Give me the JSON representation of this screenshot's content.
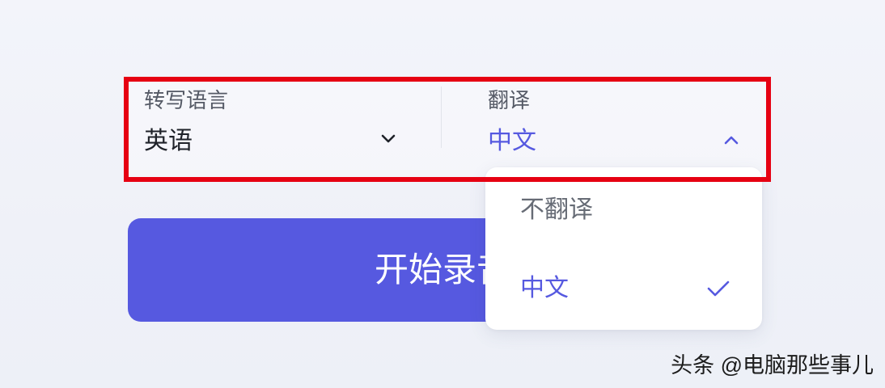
{
  "transcribe": {
    "label": "转写语言",
    "value": "英语",
    "icon": "chevron-down-icon"
  },
  "translate": {
    "label": "翻译",
    "value": "中文",
    "icon": "chevron-up-icon",
    "expanded": true
  },
  "dropdown": {
    "options": [
      {
        "label": "不翻译",
        "selected": false
      },
      {
        "label": "中文",
        "selected": true
      }
    ],
    "selected_icon": "check-icon"
  },
  "start_button": {
    "label": "开始录音"
  },
  "watermark": {
    "text": "头条 @电脑那些事儿"
  },
  "colors": {
    "accent": "#5659e0",
    "highlight": "#e60012"
  }
}
